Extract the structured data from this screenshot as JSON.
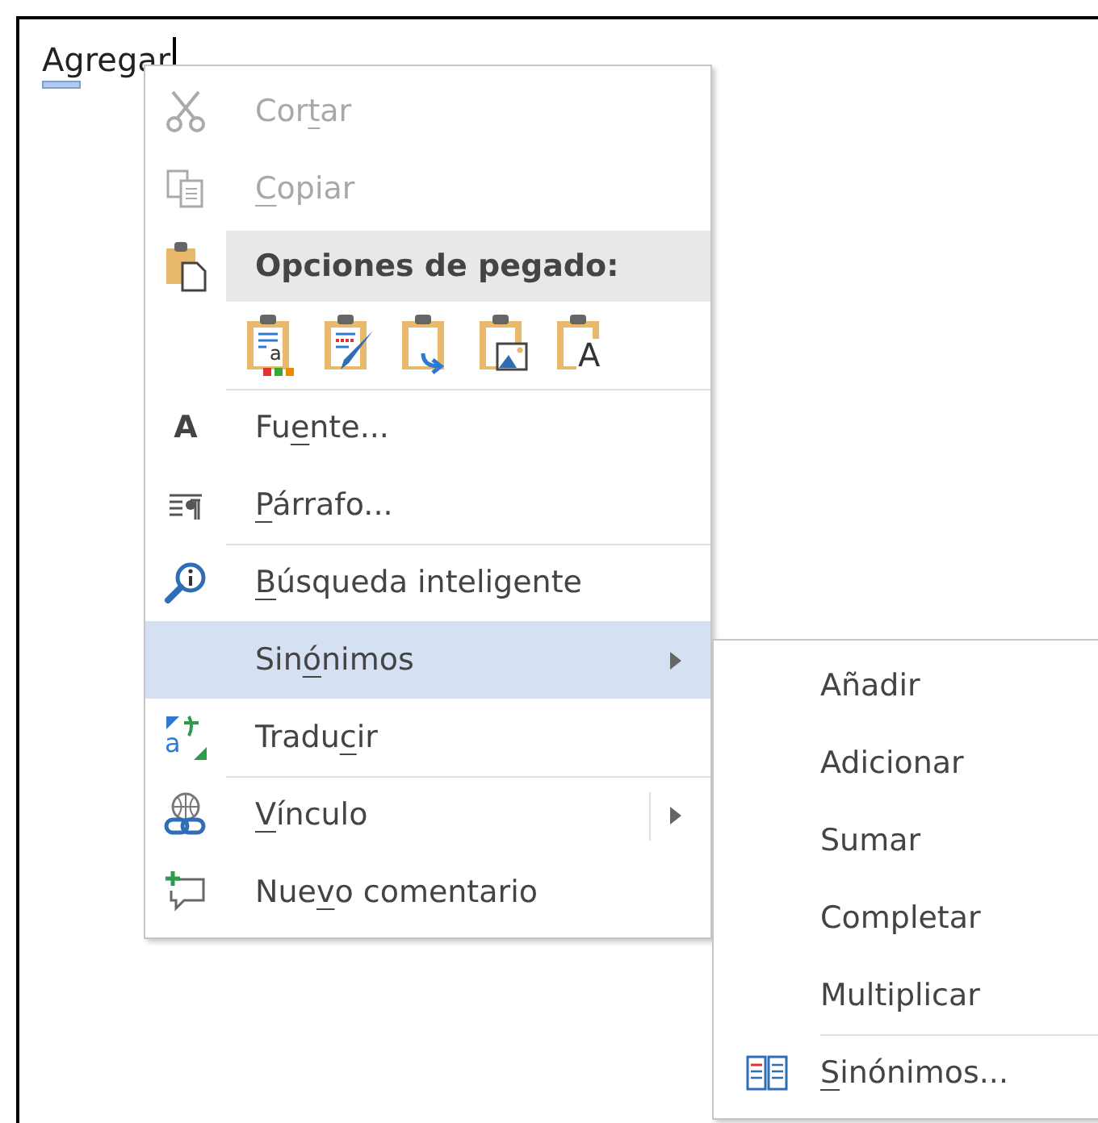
{
  "document": {
    "text": "Agregar"
  },
  "context_menu": {
    "items": [
      {
        "kind": "command",
        "label_before": "Cor",
        "access_key": "t",
        "label_after": "ar",
        "disabled": true,
        "selected": false,
        "separator_before": false
      },
      {
        "kind": "command",
        "access_key": "C",
        "label_after": "opiar",
        "disabled": true,
        "selected": false,
        "separator_before": false
      },
      {
        "kind": "header",
        "label_before": "Opciones de pegado:"
      },
      {
        "kind": "paste_options",
        "icon_marks": [
          "a",
          "A"
        ]
      },
      {
        "kind": "command",
        "label_before": "Fu",
        "access_key": "e",
        "label_after": "nte...",
        "icon_text": "A",
        "disabled": false,
        "selected": false,
        "separator_before": true
      },
      {
        "kind": "command",
        "access_key": "P",
        "label_after": "árrafo...",
        "disabled": false,
        "selected": false,
        "separator_before": false
      },
      {
        "kind": "command",
        "access_key": "B",
        "label_after": "úsqueda inteligente",
        "disabled": false,
        "selected": false,
        "separator_before": true
      },
      {
        "kind": "submenu",
        "label_before": "Sin",
        "access_key": "ó",
        "label_after": "nimos",
        "disabled": false,
        "selected": true,
        "separator_before": false
      },
      {
        "kind": "command",
        "label_before": "Tradu",
        "access_key": "c",
        "label_after": "ir",
        "icon_text": "a",
        "disabled": false,
        "selected": false,
        "separator_before": false
      },
      {
        "kind": "split_submenu",
        "access_key": "V",
        "label_after": "ínculo",
        "disabled": false,
        "selected": false,
        "separator_before": true
      },
      {
        "kind": "command",
        "label_before": "Nue",
        "access_key": "v",
        "label_after": "o comentario",
        "disabled": false,
        "selected": false,
        "separator_before": false
      }
    ]
  },
  "submenu": {
    "items": [
      {
        "kind": "synonym",
        "label_before": "Añadir",
        "separator_before": false
      },
      {
        "kind": "synonym",
        "label_before": "Adicionar",
        "separator_before": false
      },
      {
        "kind": "synonym",
        "label_before": "Sumar",
        "separator_before": false
      },
      {
        "kind": "synonym",
        "label_before": "Completar",
        "separator_before": false
      },
      {
        "kind": "synonym",
        "label_before": "Multiplicar",
        "separator_before": false
      },
      {
        "kind": "thesaurus",
        "access_key": "S",
        "label_after": "inónimos...",
        "separator_before": true
      }
    ]
  }
}
